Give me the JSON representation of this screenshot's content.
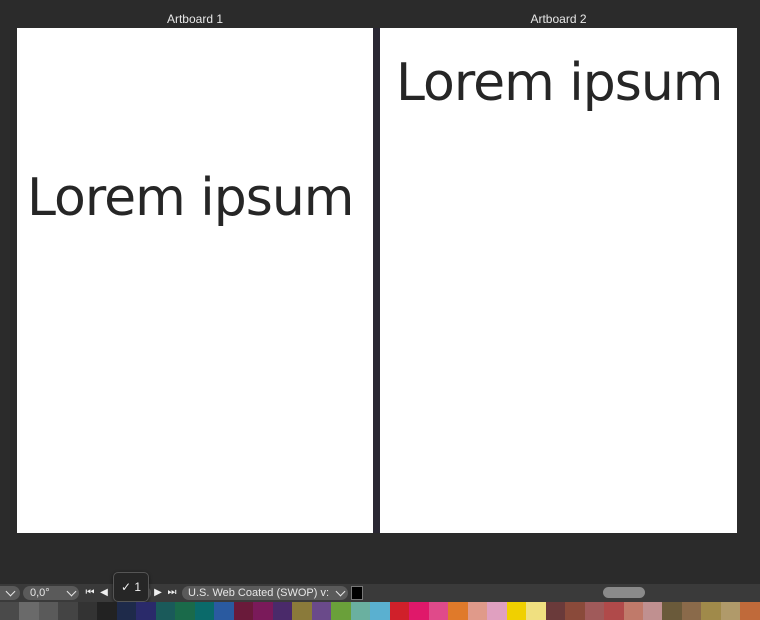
{
  "artboards": [
    {
      "title": "Artboard 1",
      "text": "Lorem ipsum"
    },
    {
      "title": "Artboard 2",
      "text": "Lorem ipsum"
    }
  ],
  "status_bar": {
    "rotation": "0,0°",
    "page_number": "✓ 1",
    "color_profile": "U.S. Web Coated (SWOP) v:",
    "nav_icons": [
      "first-page-icon",
      "prev-page-icon",
      "next-page-icon",
      "last-page-icon"
    ]
  },
  "palette": {
    "colors": [
      "#4a4a4a",
      "#6a6a6a",
      "#5a5a5a",
      "#444444",
      "#333333",
      "#222222",
      "#1e2a4a",
      "#2a2a6a",
      "#1a5a5a",
      "#1a6a4a",
      "#0a6a6a",
      "#2a5aa0",
      "#6a1a3a",
      "#7a1a5a",
      "#4a2a6a",
      "#8a7a3a",
      "#6a4a8a",
      "#6aa03a",
      "#6ab0a0",
      "#5ab0d0",
      "#d0202a",
      "#e0186a",
      "#e04a8a",
      "#e07a2a",
      "#e09a8a",
      "#e0a0c0",
      "#f0d000",
      "#f0e080",
      "#6a3a3a",
      "#8a4a3a",
      "#a05a5a",
      "#b04a4a",
      "#c07a6a",
      "#c09090",
      "#6a5a3a",
      "#8a6a4a",
      "#a08a4a",
      "#b09a6a",
      "#c06a3a"
    ]
  }
}
